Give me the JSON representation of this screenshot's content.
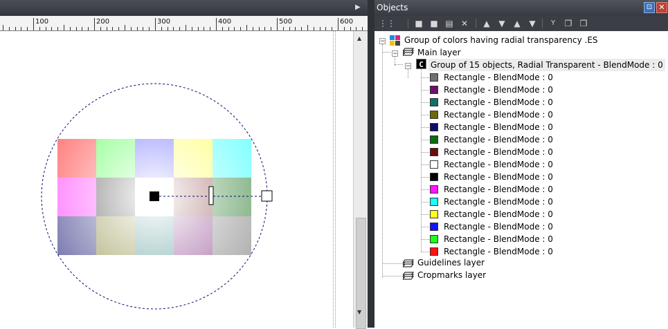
{
  "ruler": {
    "labels": [
      "100",
      "200",
      "300",
      "400",
      "500",
      "600"
    ]
  },
  "panel": {
    "title": "Objects",
    "pin_icon": "pin-icon",
    "close_icon": "close-icon"
  },
  "toolbar": {
    "icons": [
      "tree-view-icon",
      "lock-open-icon",
      "lock-icon",
      "properties-icon",
      "delete-icon",
      "move-up-icon",
      "move-down-icon",
      "move-top-icon",
      "move-bottom-icon",
      "filter-icon",
      "copy-icon",
      "paste-icon"
    ]
  },
  "tree": {
    "document": "Group of colors having radial transparency .ES",
    "main_layer": "Main layer",
    "group": "Group of 15 objects, Radial Transparent - BlendMode : 0",
    "items": [
      {
        "label": "Rectangle - BlendMode : 0",
        "color": "#707070"
      },
      {
        "label": "Rectangle - BlendMode : 0",
        "color": "#6e0f6e"
      },
      {
        "label": "Rectangle - BlendMode : 0",
        "color": "#0e6f6c"
      },
      {
        "label": "Rectangle - BlendMode : 0",
        "color": "#6b6a07"
      },
      {
        "label": "Rectangle - BlendMode : 0",
        "color": "#0d0d6e"
      },
      {
        "label": "Rectangle - BlendMode : 0",
        "color": "#0c6c10"
      },
      {
        "label": "Rectangle - BlendMode : 0",
        "color": "#6c0d0d"
      },
      {
        "label": "Rectangle - BlendMode : 0",
        "color": "#ffffff"
      },
      {
        "label": "Rectangle - BlendMode : 0",
        "color": "#000000"
      },
      {
        "label": "Rectangle - BlendMode : 0",
        "color": "#ff15ff"
      },
      {
        "label": "Rectangle - BlendMode : 0",
        "color": "#1affff"
      },
      {
        "label": "Rectangle - BlendMode : 0",
        "color": "#ffff10"
      },
      {
        "label": "Rectangle - BlendMode : 0",
        "color": "#1414ff"
      },
      {
        "label": "Rectangle - BlendMode : 0",
        "color": "#1aff1a"
      },
      {
        "label": "Rectangle - BlendMode : 0",
        "color": "#ff1212"
      }
    ],
    "guidelines_layer": "Guidelines layer",
    "cropmarks_layer": "Cropmarks layer"
  },
  "canvas": {
    "grid_colors": [
      [
        "#ff1212",
        "#1aff1a",
        "#1414ff",
        "#ffff10",
        "#1affff"
      ],
      [
        "#ff15ff",
        "#000000",
        "#ffffff",
        "#6c0d0d",
        "#0c6c10"
      ],
      [
        "#0d0d6e",
        "#6b6a07",
        "#0e6f6c",
        "#6e0f6e",
        "#707070"
      ]
    ],
    "selection_color": "#0a0a6e"
  }
}
